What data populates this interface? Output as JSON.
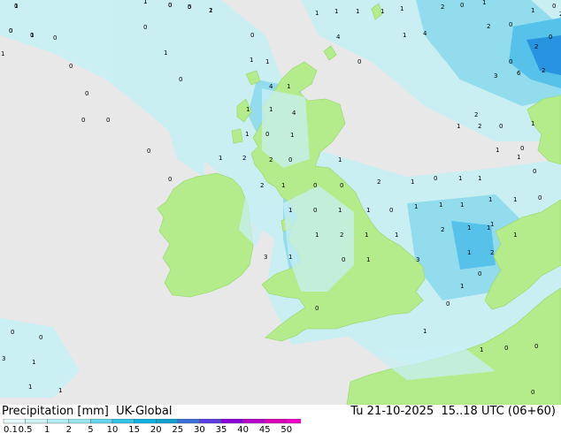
{
  "header": {
    "title_left": "Precipitation [mm]  UK-Global",
    "title_right": "Tu 21-10-2025  15..18 UTC (06+60)"
  },
  "legend": {
    "ticks": [
      "0.1",
      "0.5",
      "1",
      "2",
      "5",
      "10",
      "15",
      "20",
      "25",
      "30",
      "35",
      "40",
      "45",
      "50"
    ],
    "colors": [
      "#e6f9f9",
      "#ccf2f4",
      "#b3ecf1",
      "#99e4ee",
      "#66d4eb",
      "#33c3e8",
      "#0eb0e2",
      "#119fd0",
      "#3a6fd9",
      "#5a3ee0",
      "#8b00d9",
      "#b400c8",
      "#d900b8",
      "#f000c8"
    ]
  },
  "map": {
    "colors": {
      "sea": "#e8e8e8",
      "land": "#b4ec8c",
      "land_edge": "#9fdc77",
      "precip_light": "#c8f0f4",
      "precip_mid": "#8fdcee",
      "precip_strong": "#4fc0ea",
      "precip_heavy": "#1e8fe0"
    },
    "labels": [
      {
        "text": "1"
      },
      {
        "text": "1"
      },
      {
        "text": "0"
      },
      {
        "text": "5"
      },
      {
        "text": "1"
      },
      {
        "text": "0"
      },
      {
        "text": "1"
      },
      {
        "text": "0"
      },
      {
        "text": "1"
      },
      {
        "text": "0"
      },
      {
        "text": "0"
      },
      {
        "text": "1"
      },
      {
        "text": "1"
      },
      {
        "text": "1"
      },
      {
        "text": "1"
      },
      {
        "text": "1"
      },
      {
        "text": "2"
      },
      {
        "text": "0"
      },
      {
        "text": "1"
      },
      {
        "text": "0"
      },
      {
        "text": "1"
      },
      {
        "text": "4"
      },
      {
        "text": "1"
      },
      {
        "text": "4"
      },
      {
        "text": "0"
      },
      {
        "text": "2"
      },
      {
        "text": "0"
      },
      {
        "text": "2"
      },
      {
        "text": "0"
      },
      {
        "text": "1"
      },
      {
        "text": "0"
      },
      {
        "text": "0"
      },
      {
        "text": "1"
      },
      {
        "text": "1"
      },
      {
        "text": "0"
      },
      {
        "text": "3"
      },
      {
        "text": "6"
      },
      {
        "text": "2"
      },
      {
        "text": "0"
      },
      {
        "text": "0"
      },
      {
        "text": "0"
      },
      {
        "text": "0"
      },
      {
        "text": "1"
      },
      {
        "text": "4"
      },
      {
        "text": "1"
      },
      {
        "text": "1"
      },
      {
        "text": "4"
      },
      {
        "text": "1"
      },
      {
        "text": "0"
      },
      {
        "text": "1"
      },
      {
        "text": "2"
      },
      {
        "text": "0"
      },
      {
        "text": "1"
      },
      {
        "text": "1"
      },
      {
        "text": "2"
      },
      {
        "text": "2"
      },
      {
        "text": "1"
      },
      {
        "text": "0"
      },
      {
        "text": "0"
      },
      {
        "text": "2"
      },
      {
        "text": "1"
      },
      {
        "text": "0"
      },
      {
        "text": "1"
      },
      {
        "text": "1"
      },
      {
        "text": "1"
      },
      {
        "text": "0"
      },
      {
        "text": "2"
      },
      {
        "text": "0"
      },
      {
        "text": "1"
      },
      {
        "text": "0"
      },
      {
        "text": "1"
      },
      {
        "text": "0"
      },
      {
        "text": "1"
      },
      {
        "text": "1"
      },
      {
        "text": "0"
      },
      {
        "text": "1"
      },
      {
        "text": "1"
      },
      {
        "text": "1"
      },
      {
        "text": "1"
      },
      {
        "text": "1"
      },
      {
        "text": "2"
      },
      {
        "text": "1"
      },
      {
        "text": "1"
      },
      {
        "text": "1"
      },
      {
        "text": "1"
      },
      {
        "text": "2"
      },
      {
        "text": "1"
      },
      {
        "text": "1"
      },
      {
        "text": "1"
      },
      {
        "text": "1"
      },
      {
        "text": "2"
      },
      {
        "text": "3"
      },
      {
        "text": "1"
      },
      {
        "text": "0"
      },
      {
        "text": "1"
      },
      {
        "text": "3"
      },
      {
        "text": "0"
      },
      {
        "text": "1"
      },
      {
        "text": "0"
      },
      {
        "text": "0"
      },
      {
        "text": "1"
      },
      {
        "text": "0"
      },
      {
        "text": "0"
      },
      {
        "text": "3"
      },
      {
        "text": "1"
      },
      {
        "text": "1"
      },
      {
        "text": "0"
      },
      {
        "text": "0"
      },
      {
        "text": "1"
      },
      {
        "text": "1"
      },
      {
        "text": "0"
      },
      {
        "text": "0"
      },
      {
        "text": "1"
      },
      {
        "text": "1"
      },
      {
        "text": "2"
      },
      {
        "text": "0"
      },
      {
        "text": "2"
      },
      {
        "text": "0"
      },
      {
        "text": "1"
      },
      {
        "text": "0"
      },
      {
        "text": "0"
      },
      {
        "text": "2"
      },
      {
        "text": "0"
      },
      {
        "text": "0"
      }
    ]
  }
}
